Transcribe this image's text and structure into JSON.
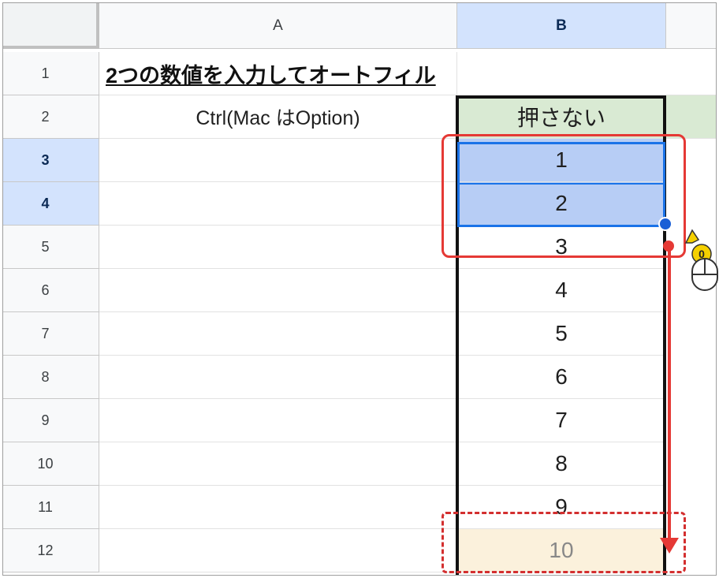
{
  "columns": [
    {
      "label": "A"
    },
    {
      "label": "B"
    }
  ],
  "title": "2つの数値を入力してオートフィル",
  "a2": "Ctrl(Mac はOption)",
  "b_header": "押さない",
  "rows": [
    "1",
    "2",
    "3",
    "4",
    "5",
    "6",
    "7",
    "8",
    "9",
    "10",
    "11",
    "12"
  ],
  "b_values": [
    "1",
    "2",
    "3",
    "4",
    "5",
    "6",
    "7",
    "8",
    "9",
    "10"
  ],
  "mouse_badge": "0",
  "colors": {
    "selection": "#1a73e8",
    "annotation": "#e53935",
    "header_green": "#d9ead3",
    "fill_preview": "#fbf1dc"
  }
}
